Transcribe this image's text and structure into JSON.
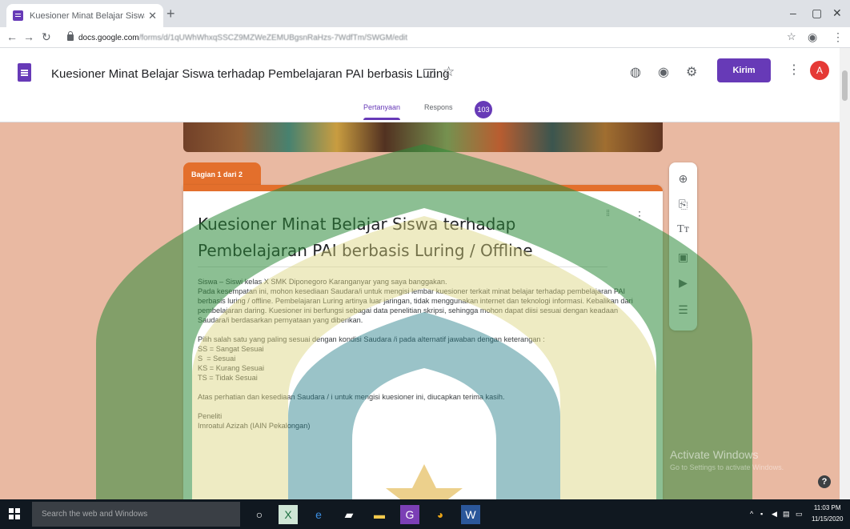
{
  "browser": {
    "tab_title": "Kuesioner Minat Belajar Siswa te",
    "url_host": "docs.google.com",
    "url_rest": "/forms/d/1qUWhWhxqSSCZ9MZWeZEMUBgsnRaHzs-7WdfTm/SWGM/edit"
  },
  "header": {
    "doc_title": "Kuesioner Minat Belajar Siswa terhadap Pembelajaran PAI berbasis Luring",
    "send_label": "Kirim",
    "avatar_letter": "A",
    "tabs": [
      {
        "label": "Pertanyaan",
        "active": true
      },
      {
        "label": "Respons",
        "active": false
      }
    ],
    "responses_count": "103"
  },
  "section": {
    "tag": "Bagian 1 dari 2"
  },
  "form": {
    "title": "Kuesioner Minat Belajar Siswa terhadap Pembelajaran PAI berbasis Luring / Offline",
    "description": "Siswa – Siswi kelas X SMK Diponegoro Karanganyar yang saya banggakan.\nPada kesempatan ini, mohon kesediaan Saudara/i untuk mengisi lembar kuesioner terkait minat belajar terhadap pembelajaran PAI berbasis luring / offline. Pembelajaran Luring artinya luar jaringan, tidak menggunakan internet dan teknologi informasi. Kebalikan dari pembelajaran daring. Kuesioner ini berfungsi sebagai data penelitian skripsi, sehingga mohon dapat diisi sesuai dengan keadaan Saudara/i berdasarkan pernyataan yang diberikan.\n\nPilih salah satu yang paling sesuai dengan kondisi Saudara /i pada alternatif jawaban dengan keterangan :\nSS = Sangat Sesuai\nS  = Sesuai\nKS = Kurang Sesuai\nTS = Tidak Sesuai\n\nAtas perhatian dan kesediaan Saudara / i untuk mengisi kuesioner ini, diucapkan terima kasih.\n\nPeneliti\nImroatul Azizah (IAIN Pekalongan)"
  },
  "windows": {
    "activate_title": "Activate Windows",
    "activate_sub": "Go to Settings to activate Windows.",
    "search_placeholder": "Search the web and Windows",
    "time": "11:03 PM",
    "date": "11/15/2020"
  },
  "colors": {
    "accent": "#673ab7",
    "theme": "#e36f2c",
    "background": "#e9b9a2"
  }
}
